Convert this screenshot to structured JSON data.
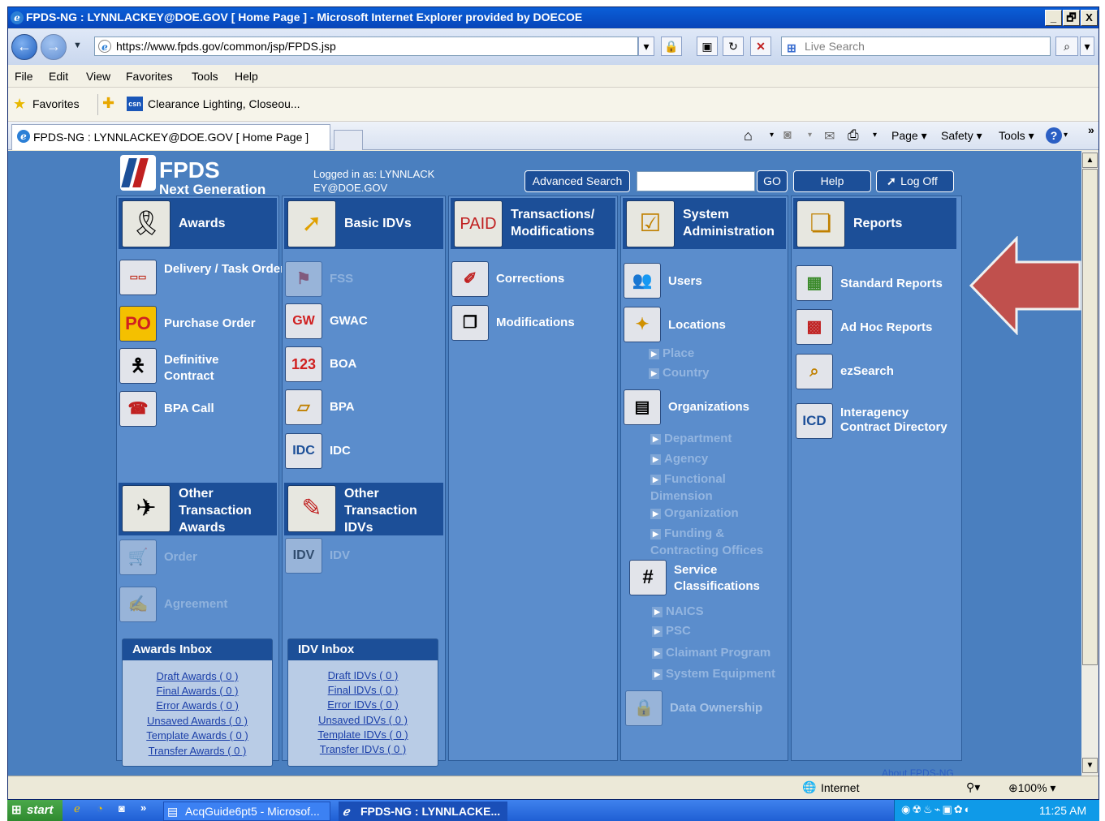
{
  "window": {
    "title": "FPDS-NG : LYNNLACKEY@DOE.GOV [ Home Page ] - Microsoft Internet Explorer provided by DOECOE",
    "controls": [
      "_",
      "🗗",
      "X"
    ]
  },
  "address": {
    "url": "https://www.fpds.gov/common/jsp/FPDS.jsp",
    "search_placeholder": "Live Search"
  },
  "menu": [
    "File",
    "Edit",
    "View",
    "Favorites",
    "Tools",
    "Help"
  ],
  "favorites": {
    "label": "Favorites",
    "link": "Clearance Lighting, Closeou..."
  },
  "tab": {
    "title": "FPDS-NG : LYNNLACKEY@DOE.GOV [ Home Page ]"
  },
  "ie_commands": [
    "Page ▾",
    "Safety ▾",
    "Tools ▾"
  ],
  "header": {
    "logo_top": "FPDS",
    "logo_bottom": "Next Generation",
    "logged_in": "Logged in as: LYNNLACK EY@DOE.GOV",
    "advanced_search": "Advanced Search",
    "go": "GO",
    "help": "Help",
    "logoff": "Log Off"
  },
  "awards": {
    "title": "Awards",
    "items": [
      "Delivery / Task Order Against IDV",
      "Purchase Order",
      "Definitive Contract",
      "BPA Call"
    ],
    "other_title": "Other Transaction Awards",
    "other_items": [
      "Order",
      "Agreement"
    ],
    "inbox_title": "Awards Inbox",
    "inbox": [
      "Draft Awards ( 0 )",
      "Final Awards ( 0 )",
      "Error Awards ( 0 )",
      "Unsaved Awards ( 0 )",
      "Template Awards ( 0 )",
      "Transfer Awards ( 0 )"
    ]
  },
  "idvs": {
    "title": "Basic IDVs",
    "items": [
      "FSS",
      "GWAC",
      "BOA",
      "BPA",
      "IDC"
    ],
    "other_title": "Other Transaction IDVs",
    "other_items": [
      "IDV"
    ],
    "inbox_title": "IDV Inbox",
    "inbox": [
      "Draft IDVs ( 0 )",
      "Final IDVs ( 0 )",
      "Error IDVs ( 0 )",
      "Unsaved IDVs ( 0 )",
      "Template IDVs ( 0 )",
      "Transfer IDVs ( 0 )"
    ]
  },
  "transactions": {
    "title": "Transactions/ Modifications",
    "items": [
      "Corrections",
      "Modifications"
    ]
  },
  "sysadmin": {
    "title": "System Administration",
    "users": "Users",
    "locations": "Locations",
    "location_subs": [
      "Place",
      "Country"
    ],
    "organizations": "Organizations",
    "org_subs": [
      "Department",
      "Agency",
      "Functional Dimension",
      "Organization",
      "Funding & Contracting Offices"
    ],
    "service": "Service Classifications",
    "service_subs": [
      "NAICS",
      "PSC",
      "Claimant Program",
      "System Equipment"
    ],
    "data_ownership": "Data Ownership"
  },
  "reports": {
    "title": "Reports",
    "items": [
      "Standard Reports",
      "Ad Hoc Reports",
      "ezSearch",
      "Interagency Contract Directory"
    ]
  },
  "about": "About FPDS-NG",
  "status": {
    "zone": "Internet",
    "zoom": "100%"
  },
  "taskbar": {
    "start": "start",
    "tasks": [
      "AcqGuide6pt5 - Microsof...",
      "FPDS-NG : LYNNLACKE..."
    ],
    "clock": "11:25 AM"
  },
  "colors": {
    "page_bg": "#4a7fbf",
    "column_bg": "#5b8dcc",
    "header_blue": "#1c4f98",
    "arrow": "#c0504d"
  }
}
